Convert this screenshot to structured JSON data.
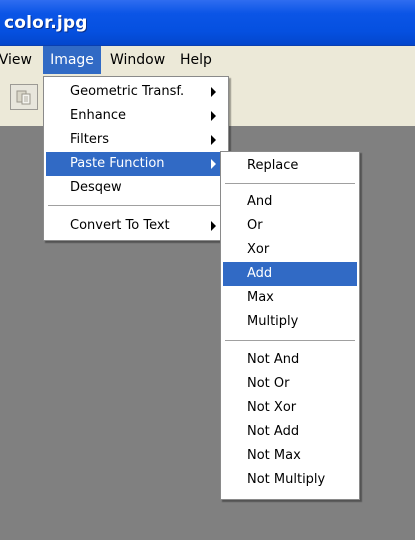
{
  "window": {
    "title": "color.jpg"
  },
  "menubar": {
    "view": "View",
    "image": "Image",
    "window": "Window",
    "help": "Help"
  },
  "image_menu": {
    "items": [
      {
        "label": "Geometric Transf.",
        "has_submenu": true
      },
      {
        "label": "Enhance",
        "has_submenu": true
      },
      {
        "label": "Filters",
        "has_submenu": true
      },
      {
        "label": "Paste Function",
        "has_submenu": true,
        "highlighted": true
      },
      {
        "label": "Desqew",
        "has_submenu": false
      },
      {
        "label": "Convert To Text",
        "has_submenu": true
      }
    ]
  },
  "paste_menu": {
    "items": [
      {
        "label": "Replace"
      },
      {
        "label": "And"
      },
      {
        "label": "Or"
      },
      {
        "label": "Xor"
      },
      {
        "label": "Add",
        "highlighted": true
      },
      {
        "label": "Max"
      },
      {
        "label": "Multiply"
      },
      {
        "label": "Not And"
      },
      {
        "label": "Not Or"
      },
      {
        "label": "Not Xor"
      },
      {
        "label": "Not Add"
      },
      {
        "label": "Not Max"
      },
      {
        "label": "Not Multiply"
      }
    ]
  },
  "colors": {
    "highlight": "#316ac5",
    "titlebar": "#0550e0",
    "menubar_bg": "#ece9d8",
    "workspace": "#808080"
  },
  "icons": {
    "toolbar_button": "paste-icon",
    "submenu_arrow": "arrow-right-icon"
  }
}
